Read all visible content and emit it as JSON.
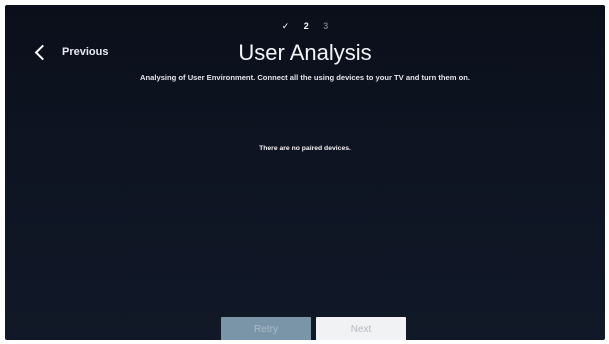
{
  "steps": {
    "completed_glyph": "✓",
    "current": "2",
    "next": "3"
  },
  "header": {
    "previous_label": "Previous",
    "title": "User Analysis",
    "subtitle": "Analysing of User Environment. Connect all the using devices to your TV and turn them on."
  },
  "main": {
    "empty_message": "There are no paired devices."
  },
  "footer": {
    "retry_label": "Retry",
    "next_label": "Next"
  },
  "colors": {
    "background": "#0e1422",
    "retry_button": "#7b95a8",
    "next_button": "#f1f2f4",
    "inactive_step": "#6f7585"
  },
  "icons": {
    "back": "chevron-left-icon",
    "step_done": "check-icon"
  }
}
